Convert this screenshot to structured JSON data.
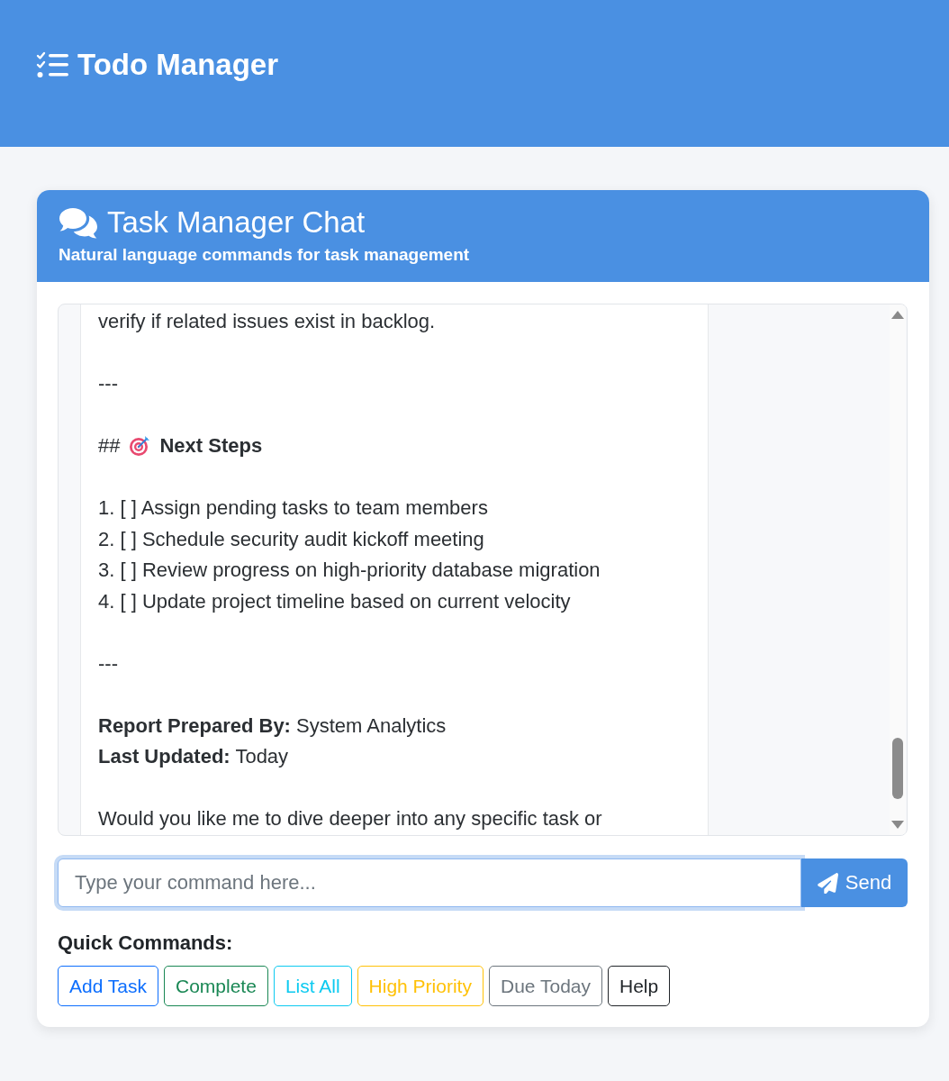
{
  "header": {
    "title": "Todo Manager"
  },
  "chat": {
    "title": "Task Manager Chat",
    "subtitle": "Natural language commands for task management",
    "message": {
      "blocks": [
        {
          "kind": "paragraph",
          "lines": [
            "verify if related issues exist in backlog."
          ]
        },
        {
          "kind": "paragraph",
          "lines": [
            "---"
          ]
        },
        {
          "kind": "heading",
          "marker": "##",
          "title": "Next Steps"
        },
        {
          "kind": "paragraph",
          "lines": [
            "1. [ ] Assign pending tasks to team members",
            "2. [ ] Schedule security audit kickoff meeting",
            "3. [ ] Review progress on high-priority database migration",
            "4. [ ] Update project timeline based on current velocity"
          ]
        },
        {
          "kind": "paragraph",
          "lines": [
            "---"
          ]
        },
        {
          "kind": "paragraph",
          "lines": [
            "**Report Prepared By:** System Analytics",
            "**Last Updated:** Today"
          ]
        },
        {
          "kind": "paragraph",
          "lines": [
            "Would you like me to dive deeper into any specific task or"
          ]
        }
      ]
    }
  },
  "input": {
    "placeholder": "Type your command here...",
    "focused": true
  },
  "send_button": {
    "label": "Send"
  },
  "quick_commands": {
    "label": "Quick Commands:",
    "buttons": [
      {
        "label": "Add Task",
        "color": "#0d6efd"
      },
      {
        "label": "Complete",
        "color": "#198754"
      },
      {
        "label": "List All",
        "color": "#0dcaf0"
      },
      {
        "label": "High Priority",
        "color": "#ffc107"
      },
      {
        "label": "Due Today",
        "color": "#6c757d"
      },
      {
        "label": "Help",
        "color": "#212529"
      }
    ]
  }
}
